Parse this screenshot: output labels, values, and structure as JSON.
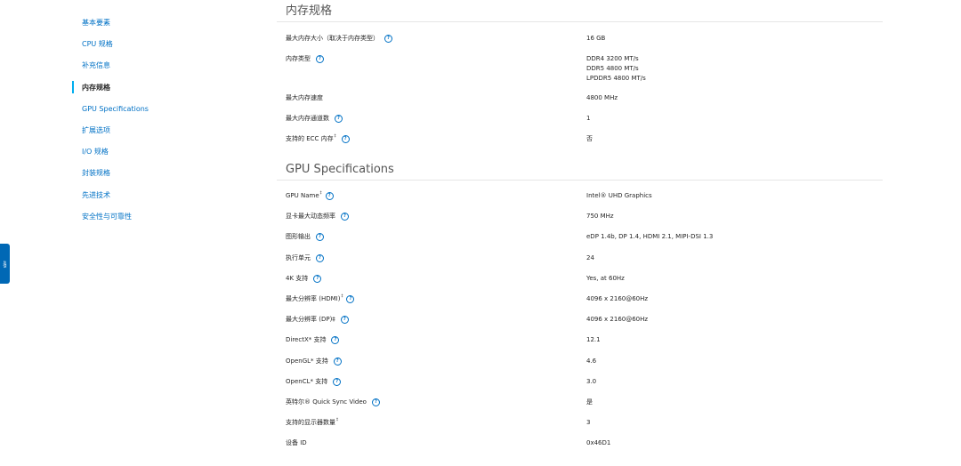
{
  "feedback_tab": {
    "label": "反馈"
  },
  "sidenav": {
    "items": [
      {
        "label": "基本要素"
      },
      {
        "label": "CPU 规格"
      },
      {
        "label": "补充信息"
      },
      {
        "label": "内存规格"
      },
      {
        "label": "GPU Specifications"
      },
      {
        "label": "扩展选项"
      },
      {
        "label": "I/O 规格"
      },
      {
        "label": "封装规格"
      },
      {
        "label": "先进技术"
      },
      {
        "label": "安全性与可靠性"
      }
    ],
    "active_index": 3
  },
  "memory": {
    "title": "内存规格",
    "rows": [
      {
        "label": "最大内存大小（取决于内存类型）",
        "value": "16 GB"
      },
      {
        "label": "内存类型",
        "value_lines": [
          "DDR4 3200 MT/s",
          "DDR5 4800 MT/s",
          "LPDDR5 4800 MT/s"
        ]
      },
      {
        "label": "最大内存速度",
        "value": "4800 MHz"
      },
      {
        "label": "最大内存通道数",
        "value": "1"
      },
      {
        "label": "支持的 ECC 内存",
        "sup": "‡",
        "value": "否"
      }
    ]
  },
  "gpu": {
    "title": "GPU Specifications",
    "rows": [
      {
        "label": "GPU Name",
        "sup": "‡",
        "value": "Intel® UHD Graphics"
      },
      {
        "label": "显卡最大动态频率",
        "value": "750 MHz"
      },
      {
        "label": "图形输出",
        "value": "eDP 1.4b, DP 1.4, HDMI 2.1, MIPI-DSI 1.3"
      },
      {
        "label": "执行单元",
        "value": "24"
      },
      {
        "label": "4K 支持",
        "value": "Yes, at 60Hz"
      },
      {
        "label": "最大分辨率 (HDMI)",
        "sup": "‡",
        "value": "4096 x 2160@60Hz"
      },
      {
        "label": "最大分辨率 (DP)‡",
        "value": "4096 x 2160@60Hz"
      },
      {
        "label": "DirectX* 支持",
        "value": "12.1"
      },
      {
        "label": "OpenGL* 支持",
        "value": "4.6"
      },
      {
        "label": "OpenCL* 支持",
        "value": "3.0"
      },
      {
        "label": "英特尔® Quick Sync Video",
        "value": "是"
      },
      {
        "label": "支持的显示器数量",
        "sup": "‡",
        "value": "3"
      },
      {
        "label": "设备 ID",
        "value": "0x46D1"
      }
    ]
  },
  "icons": {
    "help": "help-circle-icon",
    "help_glyph": "?"
  },
  "colors": {
    "link": "#0071c5",
    "active_bar": "#00aeef",
    "feedback_bg": "#0068b5"
  }
}
